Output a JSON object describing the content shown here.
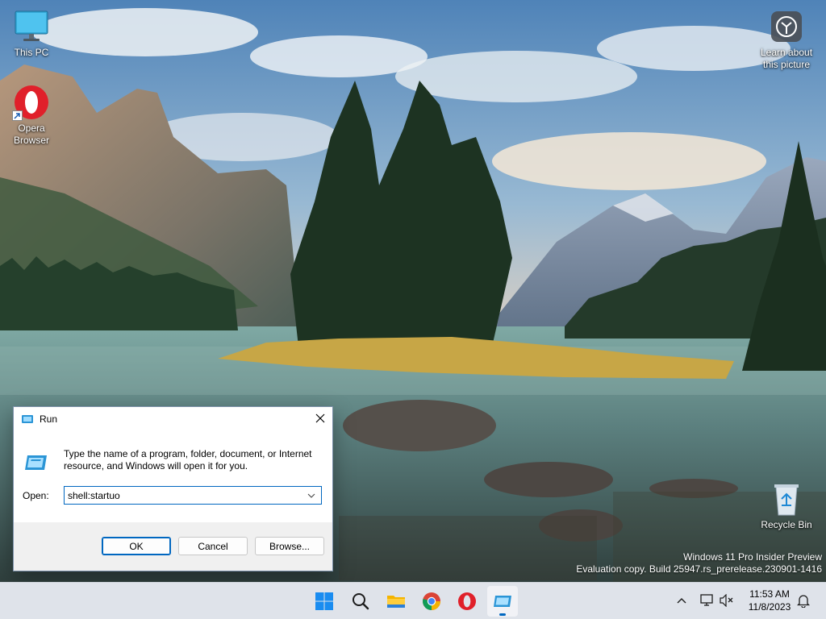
{
  "desktop": {
    "icons": [
      {
        "name": "this-pc",
        "label": "This PC",
        "icon": "monitor-icon"
      },
      {
        "name": "opera-browser",
        "label": "Opera\nBrowser",
        "icon": "opera-icon"
      },
      {
        "name": "learn-about-picture",
        "label": "Learn about\nthis picture",
        "icon": "camera-icon"
      },
      {
        "name": "recycle-bin",
        "label": "Recycle Bin",
        "icon": "recycle-bin-icon"
      }
    ],
    "watermark": {
      "line1": "Windows 11 Pro Insider Preview",
      "line2": "Evaluation copy. Build 25947.rs_prerelease.230901-1416"
    }
  },
  "run_dialog": {
    "title": "Run",
    "description": "Type the name of a program, folder, document, or Internet resource, and Windows will open it for you.",
    "open_label": "Open:",
    "input_value": "shell:startuo",
    "ok_label": "OK",
    "cancel_label": "Cancel",
    "browse_label": "Browse..."
  },
  "taskbar": {
    "apps": [
      {
        "name": "start",
        "icon": "windows-start-icon"
      },
      {
        "name": "search",
        "icon": "search-icon"
      },
      {
        "name": "file-explorer",
        "icon": "folder-icon"
      },
      {
        "name": "chrome",
        "icon": "chrome-icon"
      },
      {
        "name": "opera",
        "icon": "opera-icon"
      },
      {
        "name": "run",
        "icon": "run-icon",
        "active": true
      }
    ],
    "tray": [
      "chevron-up-icon",
      "network-icon",
      "volume-muted-icon",
      "notification-bell-icon"
    ],
    "clock": {
      "time": "11:53 AM",
      "date": "11/8/2023"
    }
  },
  "colors": {
    "accent": "#0067c0",
    "taskbar": "#dfe3ea"
  }
}
